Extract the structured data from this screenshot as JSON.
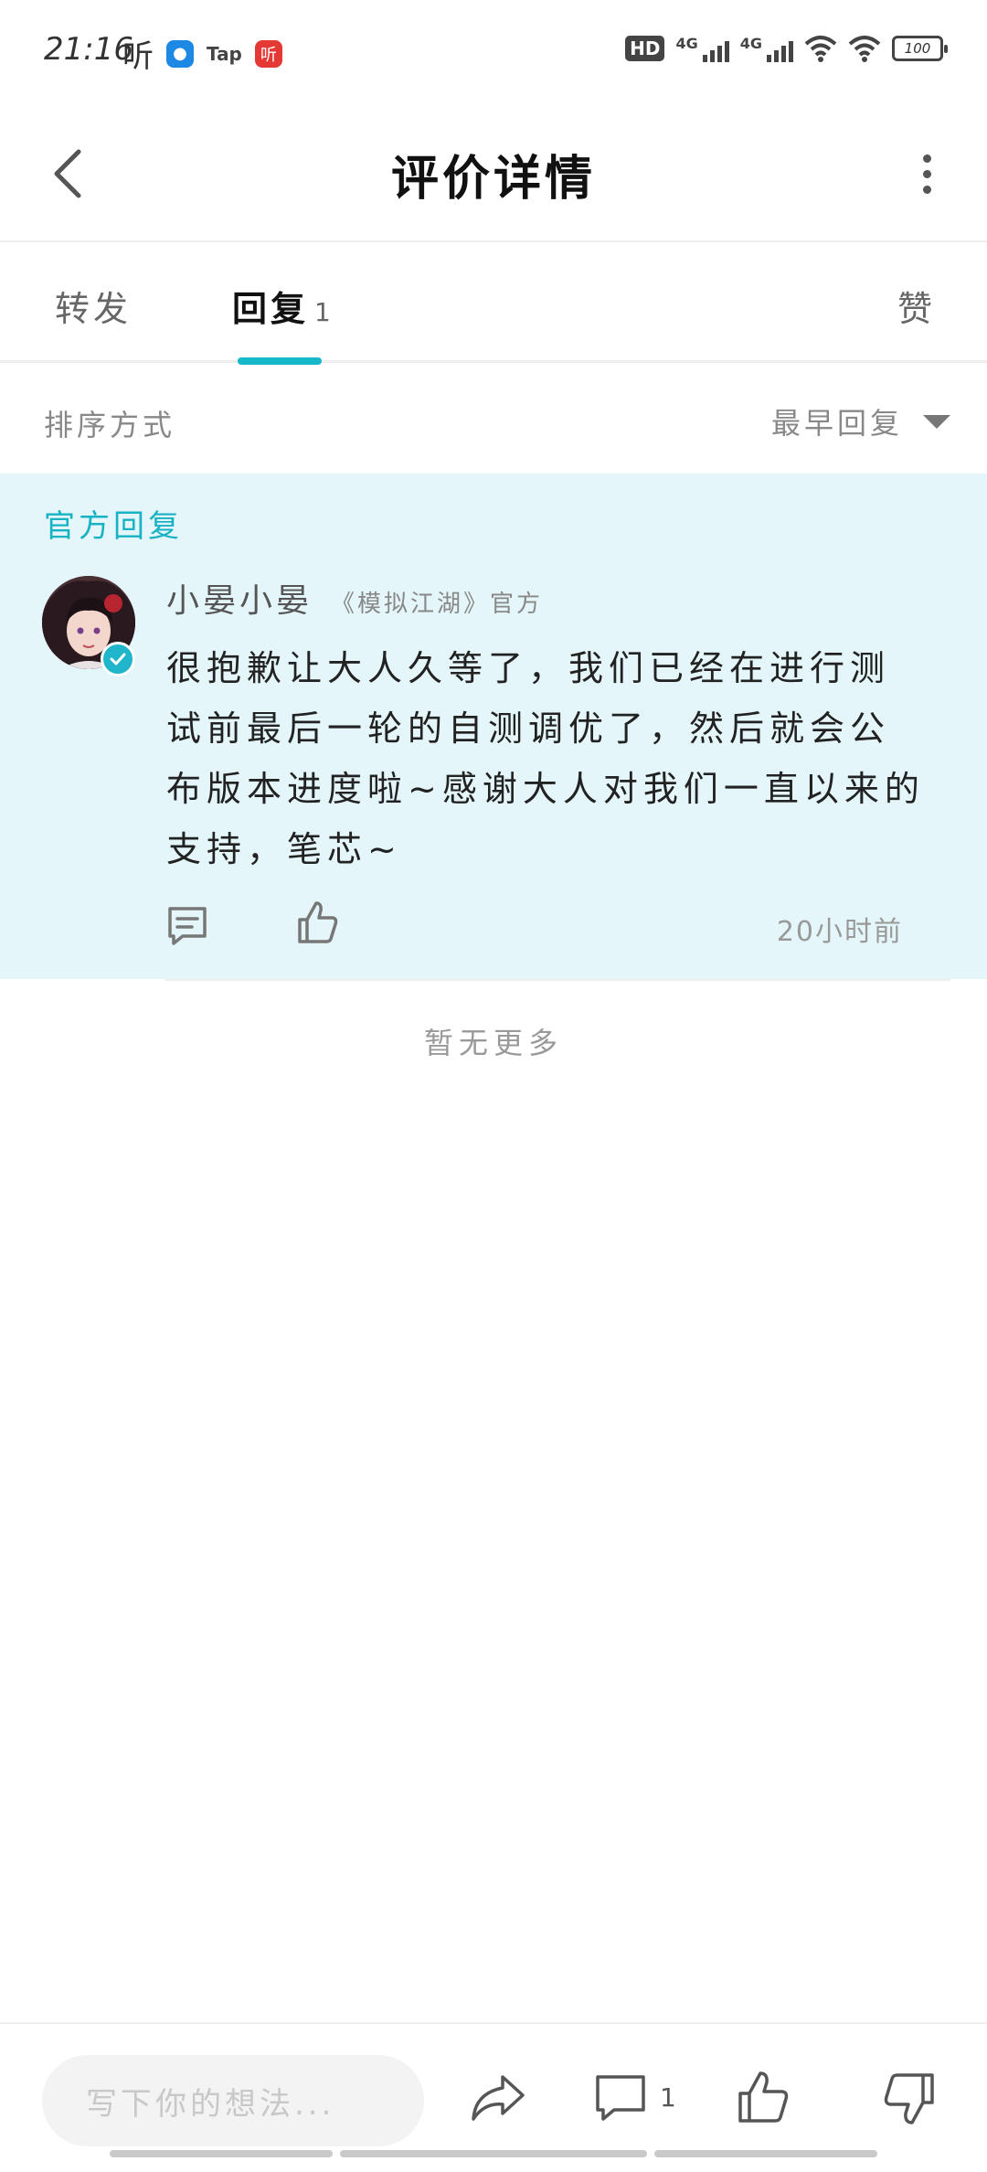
{
  "status_bar": {
    "time": "21:16",
    "app1": "听",
    "app2": "Tap",
    "app3": "听",
    "hd": "HD",
    "net1": "4G",
    "net2": "4G",
    "battery": "100"
  },
  "header": {
    "title": "评价详情"
  },
  "tabs": {
    "forward": "转发",
    "reply": "回复",
    "reply_count": "1",
    "like": "赞"
  },
  "sort": {
    "label": "排序方式",
    "selected": "最早回复"
  },
  "official_reply": {
    "section_label": "官方回复",
    "author": "小晏小晏",
    "author_tag": "《模拟江湖》官方",
    "text": "很抱歉让大人久等了，我们已经在进行测试前最后一轮的自测调优了，然后就会公布版本进度啦~感谢大人对我们一直以来的支持，笔芯~",
    "time": "20小时前"
  },
  "list_end": "暂无更多",
  "bottom_bar": {
    "placeholder": "写下你的想法...",
    "comment_count": "1"
  },
  "colors": {
    "accent": "#15b7c9",
    "card_bg": "#e4f6f9"
  },
  "icons": [
    "back-arrow-icon",
    "more-vertical-icon",
    "verified-icon",
    "comment-icon",
    "thumbs-up-icon",
    "share-icon",
    "thumbs-down-icon",
    "wifi-icon",
    "battery-icon"
  ]
}
